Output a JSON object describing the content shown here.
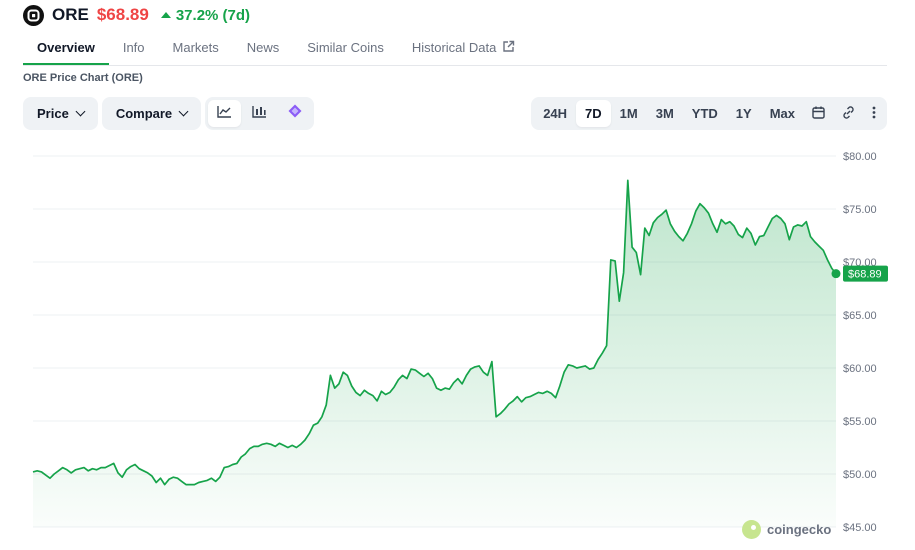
{
  "header": {
    "symbol": "ORE",
    "price": "$68.89",
    "change": "37.2% (7d)"
  },
  "tabs": [
    {
      "label": "Overview",
      "active": true
    },
    {
      "label": "Info"
    },
    {
      "label": "Markets"
    },
    {
      "label": "News"
    },
    {
      "label": "Similar Coins"
    },
    {
      "label": "Historical Data",
      "external": true
    }
  ],
  "chart_title": "ORE Price Chart (ORE)",
  "toolbar": {
    "price_label": "Price",
    "compare_label": "Compare",
    "view_icons": [
      "line-chart-icon",
      "candlestick-icon",
      "tradingview-icon"
    ],
    "ranges": [
      "24H",
      "7D",
      "1M",
      "3M",
      "YTD",
      "1Y",
      "Max"
    ],
    "active_range": "7D",
    "right_icons": [
      "calendar-icon",
      "link-icon",
      "more-icon"
    ]
  },
  "watermark": "coingecko",
  "colors": {
    "line": "#16a34a",
    "price_red": "#ef4444",
    "change_green": "#16a34a"
  },
  "chart_data": {
    "type": "area",
    "title": "ORE Price Chart (ORE)",
    "yticks": [
      "$45.00",
      "$50.00",
      "$55.00",
      "$60.00",
      "$65.00",
      "$70.00",
      "$75.00",
      "$80.00"
    ],
    "ylim": [
      45,
      80
    ],
    "grid": true,
    "current_label": "$68.89",
    "values": [
      50.2,
      50.3,
      50.2,
      49.9,
      49.6,
      50.0,
      50.3,
      50.6,
      50.4,
      50.1,
      50.4,
      50.5,
      50.6,
      50.3,
      50.5,
      50.4,
      50.6,
      50.6,
      50.8,
      51.0,
      50.1,
      49.7,
      50.4,
      50.7,
      50.9,
      50.5,
      50.3,
      50.1,
      49.8,
      49.2,
      49.6,
      49.0,
      49.5,
      49.7,
      49.6,
      49.3,
      49.0,
      49.0,
      49.0,
      49.2,
      49.3,
      49.4,
      49.6,
      49.3,
      49.7,
      50.6,
      50.7,
      50.9,
      51.0,
      51.6,
      51.9,
      52.4,
      52.6,
      52.6,
      52.8,
      52.9,
      52.8,
      52.6,
      52.9,
      52.7,
      52.5,
      52.7,
      52.5,
      52.8,
      53.2,
      53.8,
      54.6,
      54.8,
      55.4,
      56.5,
      59.3,
      58.1,
      58.5,
      59.6,
      59.3,
      58.3,
      57.7,
      57.4,
      57.9,
      57.6,
      57.4,
      56.9,
      57.8,
      57.5,
      57.7,
      58.2,
      58.9,
      59.3,
      59.0,
      59.9,
      59.8,
      59.5,
      59.2,
      59.5,
      59.0,
      58.1,
      57.9,
      58.1,
      58.0,
      58.6,
      59.0,
      58.5,
      59.3,
      59.9,
      60.1,
      60.2,
      59.6,
      59.3,
      60.6,
      55.4,
      55.7,
      56.1,
      56.6,
      56.9,
      57.3,
      56.8,
      57.2,
      57.3,
      57.5,
      57.7,
      57.6,
      57.8,
      57.6,
      57.2,
      58.3,
      59.6,
      60.3,
      60.2,
      60.0,
      60.1,
      60.2,
      59.9,
      60.0,
      60.8,
      61.4,
      62.1,
      70.2,
      70.1,
      66.3,
      69.0,
      77.7,
      71.4,
      70.9,
      68.8,
      73.2,
      72.5,
      73.7,
      74.2,
      74.5,
      74.9,
      73.6,
      72.9,
      72.4,
      72.0,
      72.7,
      73.6,
      74.8,
      75.5,
      75.1,
      74.6,
      73.6,
      72.8,
      74.0,
      73.6,
      73.8,
      73.4,
      72.6,
      72.3,
      73.2,
      72.7,
      71.6,
      72.4,
      72.5,
      73.3,
      74.1,
      74.4,
      74.1,
      73.6,
      72.1,
      73.3,
      73.5,
      73.4,
      73.8,
      72.4,
      71.9,
      71.5,
      71.1,
      70.2,
      69.4,
      68.9
    ]
  }
}
